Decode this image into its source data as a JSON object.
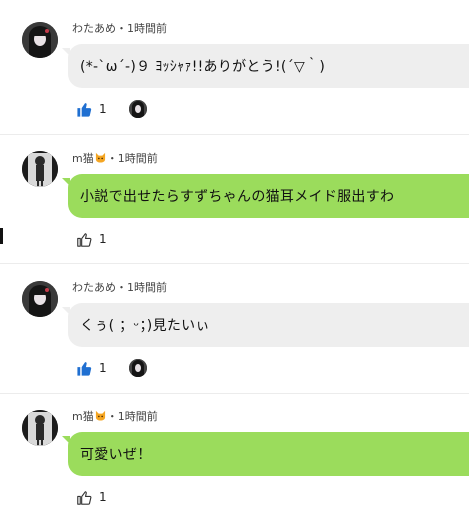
{
  "comments": [
    {
      "user": "わたあめ",
      "separator": "・",
      "time": "1時間前",
      "text": "(*-`ω´-)９ ﾖｯｼｬｧ!!ありがとう!(´▽｀)",
      "likes": "1",
      "liked": true,
      "bubble": "gray",
      "avatar_icon": "dark-hair-girl-avatar"
    },
    {
      "user": "m猫",
      "badge_icon": "cat-face-icon",
      "separator": "・",
      "time": "1時間前",
      "text": "小説で出せたらすずちゃんの猫耳メイド服出すわ",
      "likes": "1",
      "liked": false,
      "bubble": "green",
      "avatar_icon": "standing-figure-avatar"
    },
    {
      "user": "わたあめ",
      "separator": "・",
      "time": "1時間前",
      "text": "くぅ( ；ᵕ；)見たいぃ",
      "likes": "1",
      "liked": true,
      "bubble": "gray",
      "avatar_icon": "dark-hair-girl-avatar"
    },
    {
      "user": "m猫",
      "badge_icon": "cat-face-icon",
      "separator": "・",
      "time": "1時間前",
      "text": "可愛いぜ！",
      "likes": "1",
      "liked": false,
      "bubble": "green",
      "avatar_icon": "standing-figure-avatar"
    }
  ],
  "colors": {
    "liked_thumb": "#1f6fd1",
    "unliked_thumb": "#333333",
    "gray_bubble": "#eeeeee",
    "green_bubble": "#9bdc5c"
  }
}
